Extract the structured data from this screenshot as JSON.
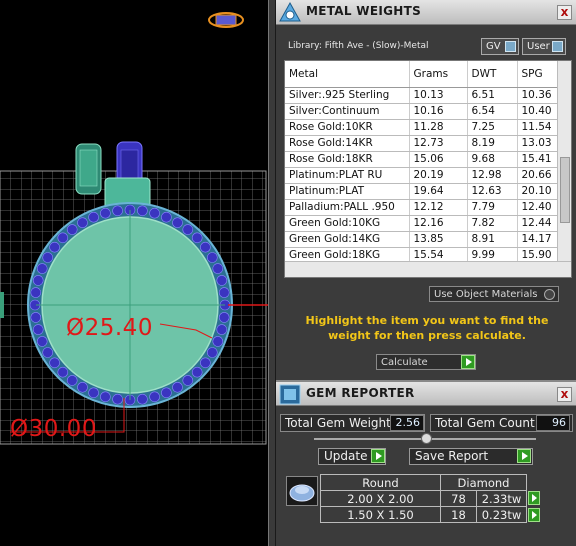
{
  "viewport": {
    "outer_dimension": "Ø30.00",
    "inner_dimension": "Ø25.40",
    "colors": {
      "grid": "#7a7a7a",
      "ring_body": "#6ec4a8",
      "ring_band": "#2e7fa0",
      "gem_setting": "#3a34c0",
      "dimension": "#e01818"
    }
  },
  "metal_weights": {
    "title": "METAL WEIGHTS",
    "close_label": "x",
    "library_label": "Library: Fifth Ave - (Slow)-Metal",
    "toggle_gv": "GV",
    "toggle_user": "User",
    "columns": [
      "Metal",
      "Grams",
      "DWT",
      "SPG"
    ],
    "rows": [
      [
        "Silver:.925 Sterling",
        "10.13",
        "6.51",
        "10.36"
      ],
      [
        "Silver:Continuum",
        "10.16",
        "6.54",
        "10.40"
      ],
      [
        "Rose Gold:10KR",
        "11.28",
        "7.25",
        "11.54"
      ],
      [
        "Rose Gold:14KR",
        "12.73",
        "8.19",
        "13.03"
      ],
      [
        "Rose Gold:18KR",
        "15.06",
        "9.68",
        "15.41"
      ],
      [
        "Platinum:PLAT RU",
        "20.19",
        "12.98",
        "20.66"
      ],
      [
        "Platinum:PLAT",
        "19.64",
        "12.63",
        "20.10"
      ],
      [
        "Palladium:PALL .950",
        "12.12",
        "7.79",
        "12.40"
      ],
      [
        "Green Gold:10KG",
        "12.16",
        "7.82",
        "12.44"
      ],
      [
        "Green Gold:14KG",
        "13.85",
        "8.91",
        "14.17"
      ],
      [
        "Green Gold:18KG",
        "15.54",
        "9.99",
        "15.90"
      ]
    ],
    "use_object_materials": "Use Object Materials",
    "instructions": "Highlight the item you want to find the weight for then press calculate.",
    "calculate_label": "Calculate",
    "accent_color": "#f2c618"
  },
  "gem_reporter": {
    "title": "GEM REPORTER",
    "close_label": "x",
    "total_weight_label": "Total Gem Weight",
    "total_weight_value": "2.56",
    "total_count_label": "Total Gem Count",
    "total_count_value": "96",
    "update_label": "Update",
    "save_report_label": "Save Report",
    "table_header_shape": "Round",
    "table_header_type": "Diamond",
    "rows": [
      {
        "size": "2.00 X 2.00",
        "count": "78",
        "weight": "2.33tw"
      },
      {
        "size": "1.50 X 1.50",
        "count": "18",
        "weight": "0.23tw"
      }
    ]
  }
}
